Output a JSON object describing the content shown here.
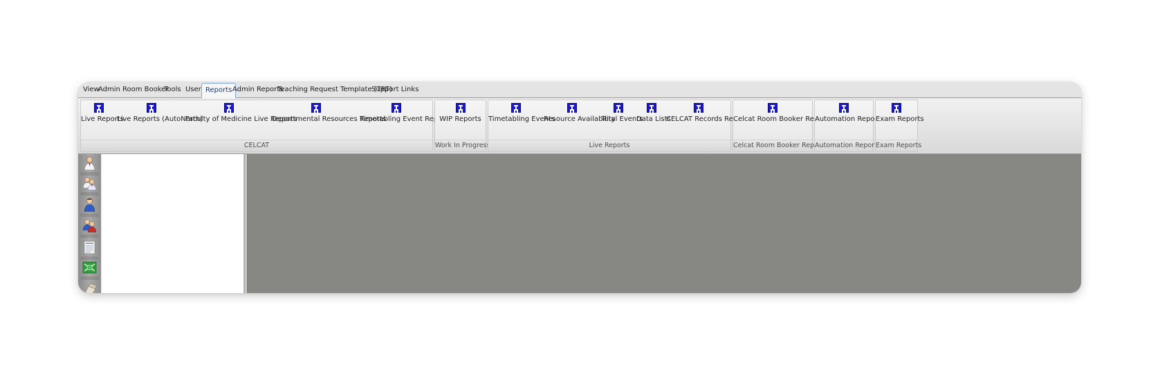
{
  "menu": {
    "tabs": [
      "View",
      "Admin",
      "Room Booker",
      "Tools",
      "User",
      "Reports",
      "Admin Reports",
      "Teaching Request Template (TRT)",
      "Support Links"
    ],
    "active_tab": "Reports"
  },
  "ribbon": {
    "groups": [
      {
        "label": "CELCAT",
        "buttons": [
          "Live Reports",
          "Live Reports (AutoNorth)",
          "Faculty of Medicine Live Reports",
          "Departmental Resources Reports",
          "Timetabling Event Reports"
        ]
      },
      {
        "label": "Work In Progress",
        "buttons": [
          "WIP Reports"
        ]
      },
      {
        "label": "Live Reports",
        "buttons": [
          "Timetabling Events",
          "Resource Availability",
          "Total Events",
          "Data Lists",
          "CELCAT Records Reports"
        ]
      },
      {
        "label": "Celcat Room Booker Reports",
        "buttons": [
          "Celcat Room Booker Reports"
        ]
      },
      {
        "label": "Automation Reports",
        "buttons": [
          "Automation Reports"
        ]
      },
      {
        "label": "Exam Reports",
        "buttons": [
          "Exam Reports"
        ]
      }
    ],
    "button_icon": "report-icon"
  },
  "sidebar": {
    "icons": [
      "staff-icon",
      "staff-group-icon",
      "student-icon",
      "student-group-icon",
      "modules-icon",
      "rooms-icon",
      "equipment-icon"
    ]
  },
  "colors": {
    "workspace": "#878884",
    "tab_strip": "#e4e4e4",
    "report_icon": "#1a1ac9",
    "active_tab_border": "#7ea8d6"
  }
}
